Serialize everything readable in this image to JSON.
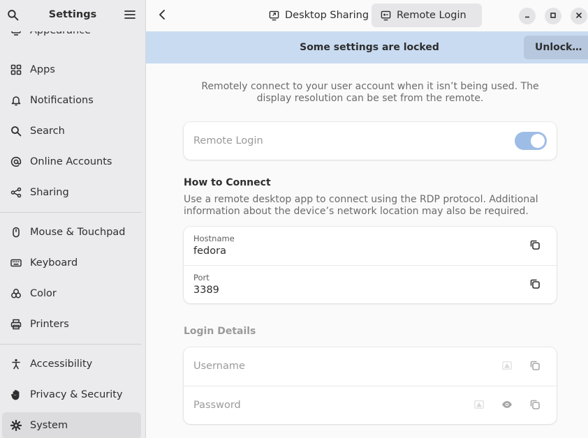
{
  "sidebar": {
    "title": "Settings",
    "items": [
      {
        "label": "Appearance",
        "icon": "appearance-icon"
      },
      {
        "label": "Apps",
        "icon": "apps-grid-icon"
      },
      {
        "label": "Notifications",
        "icon": "bell-icon"
      },
      {
        "label": "Search",
        "icon": "search-icon"
      },
      {
        "label": "Online Accounts",
        "icon": "at-sign-icon"
      },
      {
        "label": "Sharing",
        "icon": "share-icon"
      },
      {
        "label": "Mouse & Touchpad",
        "icon": "mouse-icon"
      },
      {
        "label": "Keyboard",
        "icon": "keyboard-icon"
      },
      {
        "label": "Color",
        "icon": "color-icon"
      },
      {
        "label": "Printers",
        "icon": "printer-icon"
      },
      {
        "label": "Accessibility",
        "icon": "accessibility-icon"
      },
      {
        "label": "Privacy & Security",
        "icon": "hand-icon"
      },
      {
        "label": "System",
        "icon": "gear-icon"
      }
    ],
    "selected": "System"
  },
  "header": {
    "tabs": [
      {
        "label": "Desktop Sharing",
        "icon": "desktop-sharing-icon"
      },
      {
        "label": "Remote Login",
        "icon": "remote-login-icon"
      }
    ],
    "active_tab": "Remote Login"
  },
  "banner": {
    "text": "Some settings are locked",
    "button": "Unlock…"
  },
  "main": {
    "description": "Remotely connect to your user account when it isn’t being used. The display resolution can be set from the remote.",
    "remote_login": {
      "label": "Remote Login",
      "enabled": true
    },
    "how_to_connect": {
      "title": "How to Connect",
      "description": "Use a remote desktop app to connect using the RDP protocol. Additional information about the device’s network location may also be required.",
      "hostname": {
        "label": "Hostname",
        "value": "fedora"
      },
      "port": {
        "label": "Port",
        "value": "3389"
      }
    },
    "login_details": {
      "title": "Login Details",
      "username_placeholder": "Username",
      "password_placeholder": "Password"
    }
  },
  "colors": {
    "accent": "#9ebde6",
    "banner": "#c9dbf1",
    "sidebar_bg": "#ebebed"
  }
}
